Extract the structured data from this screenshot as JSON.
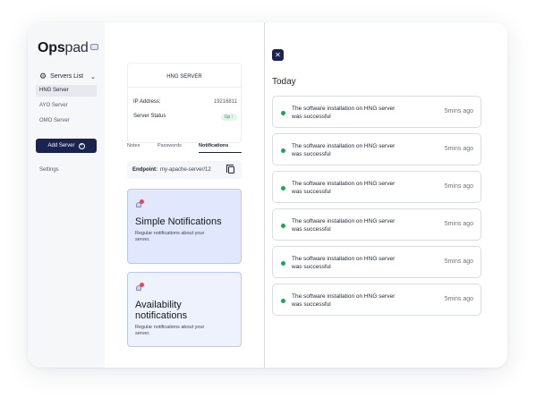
{
  "brand": {
    "name_bold": "Ops",
    "name_regular": "pad",
    "badge_icon": "window-icon"
  },
  "sidebar": {
    "section_label": "Servers List",
    "section_icon": "gear-icon",
    "items": [
      {
        "label": "HNG Server",
        "active": true
      },
      {
        "label": "AYO Server",
        "active": false
      },
      {
        "label": "OMO Server",
        "active": false
      }
    ],
    "add_button": "Add Server",
    "settings": "Settings"
  },
  "server": {
    "title": "HNG SERVER",
    "ip_label": "IP Address:",
    "ip_value": "19216811",
    "status_label": "Server Status",
    "status_value": "Up"
  },
  "tabs": [
    {
      "label": "Notes",
      "active": false
    },
    {
      "label": "Passwords",
      "active": false
    },
    {
      "label": "Notifications",
      "active": true,
      "badge": ""
    }
  ],
  "endpoint": {
    "label": "Endpoint:",
    "value": "my-apache-server/12"
  },
  "cards": [
    {
      "title": "Simple Notifications",
      "description": "Regular notifications about your server."
    },
    {
      "title": "Availability notifications",
      "description": "Regular notifications about your server."
    }
  ],
  "panel": {
    "heading": "Today",
    "close_icon": "close-icon",
    "notifications": [
      {
        "message": "The software installation on HNG server was successful",
        "time": "5mins ago"
      },
      {
        "message": "The software installation on HNG server was successful",
        "time": "5mins ago"
      },
      {
        "message": "The software installation on HNG server was successful",
        "time": "5mins ago"
      },
      {
        "message": "The software installation on HNG server was successful",
        "time": "5mins ago"
      },
      {
        "message": "The software installation on HNG server was successful",
        "time": "5mins ago"
      },
      {
        "message": "The software installation on HNG server was successful",
        "time": "5mins ago"
      }
    ]
  },
  "colors": {
    "primary": "#1b2350",
    "success": "#22a35a",
    "danger": "#e5484d",
    "card_blue": "#e1e8fd"
  }
}
